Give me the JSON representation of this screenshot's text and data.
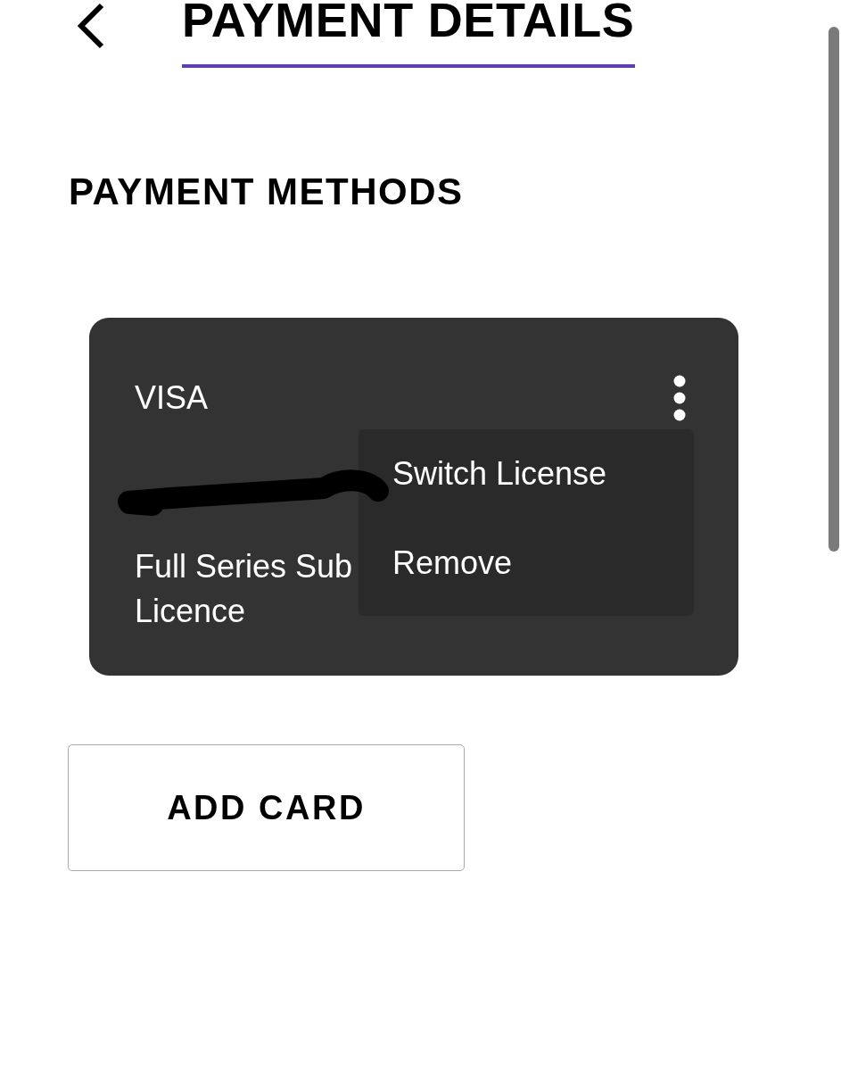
{
  "header": {
    "title": "PAYMENT DETAILS"
  },
  "payment_methods": {
    "heading": "PAYMENT METHODS",
    "cards": [
      {
        "brand": "VISA",
        "redacted": true,
        "plan_lines": [
          "Full Series Sub",
          "Licence"
        ],
        "menu": {
          "open": true,
          "items": [
            {
              "label": "Switch License"
            },
            {
              "label": "Remove"
            }
          ]
        }
      }
    ],
    "add_button": {
      "label": "ADD CARD"
    }
  }
}
